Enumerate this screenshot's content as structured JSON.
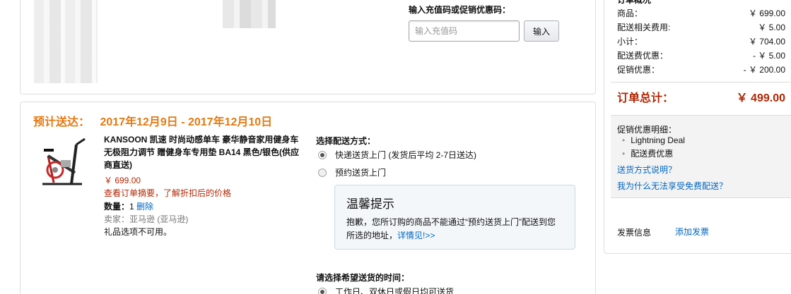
{
  "promo": {
    "title": "输入充值码或促销优惠码：",
    "placeholder": "输入充值码",
    "button": "输入"
  },
  "delivery": {
    "label": "预计送达：",
    "range": "2017年12月9日 - 2017年12月10日"
  },
  "product": {
    "title": "KANSOON 凯速 时尚动感单车 豪华静音家用健身车 无极阻力调节 赠健身车专用垫 BA14 黑色/银色(供应商直送)",
    "price": "￥ 699.00",
    "note": "查看订单摘要，了解折扣后的价格",
    "qty_label": "数量：",
    "qty_value": "1",
    "delete": "删除",
    "seller": "卖家：亚马逊 (亚马逊)",
    "gift": "礼品选项不可用。"
  },
  "shipping": {
    "title": "选择配送方式：",
    "options": [
      {
        "label": "快递送货上门 (发货后平均 2-7日送达)",
        "checked": true
      },
      {
        "label": "预约送货上门",
        "checked": false
      }
    ]
  },
  "notice": {
    "title": "温馨提示",
    "body": "抱歉，您所订购的商品不能通过“预约送货上门”配送到您所选的地址，",
    "link": "详情见!>>"
  },
  "time": {
    "title": "请选择希望送货的时间：",
    "option": "工作日、双休日或假日均可送货"
  },
  "summary": {
    "head": "订单概况",
    "rows": [
      {
        "label": "商品：",
        "value": "￥ 699.00"
      },
      {
        "label": "配送相关费用:",
        "value": "￥ 5.00"
      },
      {
        "label": "小计：",
        "value": "￥ 704.00"
      },
      {
        "label": "配送费优惠：",
        "value": "- ￥ 5.00"
      },
      {
        "label": "促销优惠：",
        "value": "- ￥ 200.00"
      }
    ],
    "total_label": "订单总计：",
    "total_value": "￥ 499.00",
    "promo_detail_title": "促销优惠明细：",
    "promo_items": [
      "Lightning Deal",
      "配送费优惠"
    ],
    "links": [
      "送货方式说明？",
      "我为什么无法享受免费配送？"
    ],
    "invoice_label": "发票信息",
    "invoice_link": "添加发票"
  },
  "colors": {
    "orange": "#e47911",
    "price_red": "#b12704",
    "link_blue": "#0066c0"
  }
}
